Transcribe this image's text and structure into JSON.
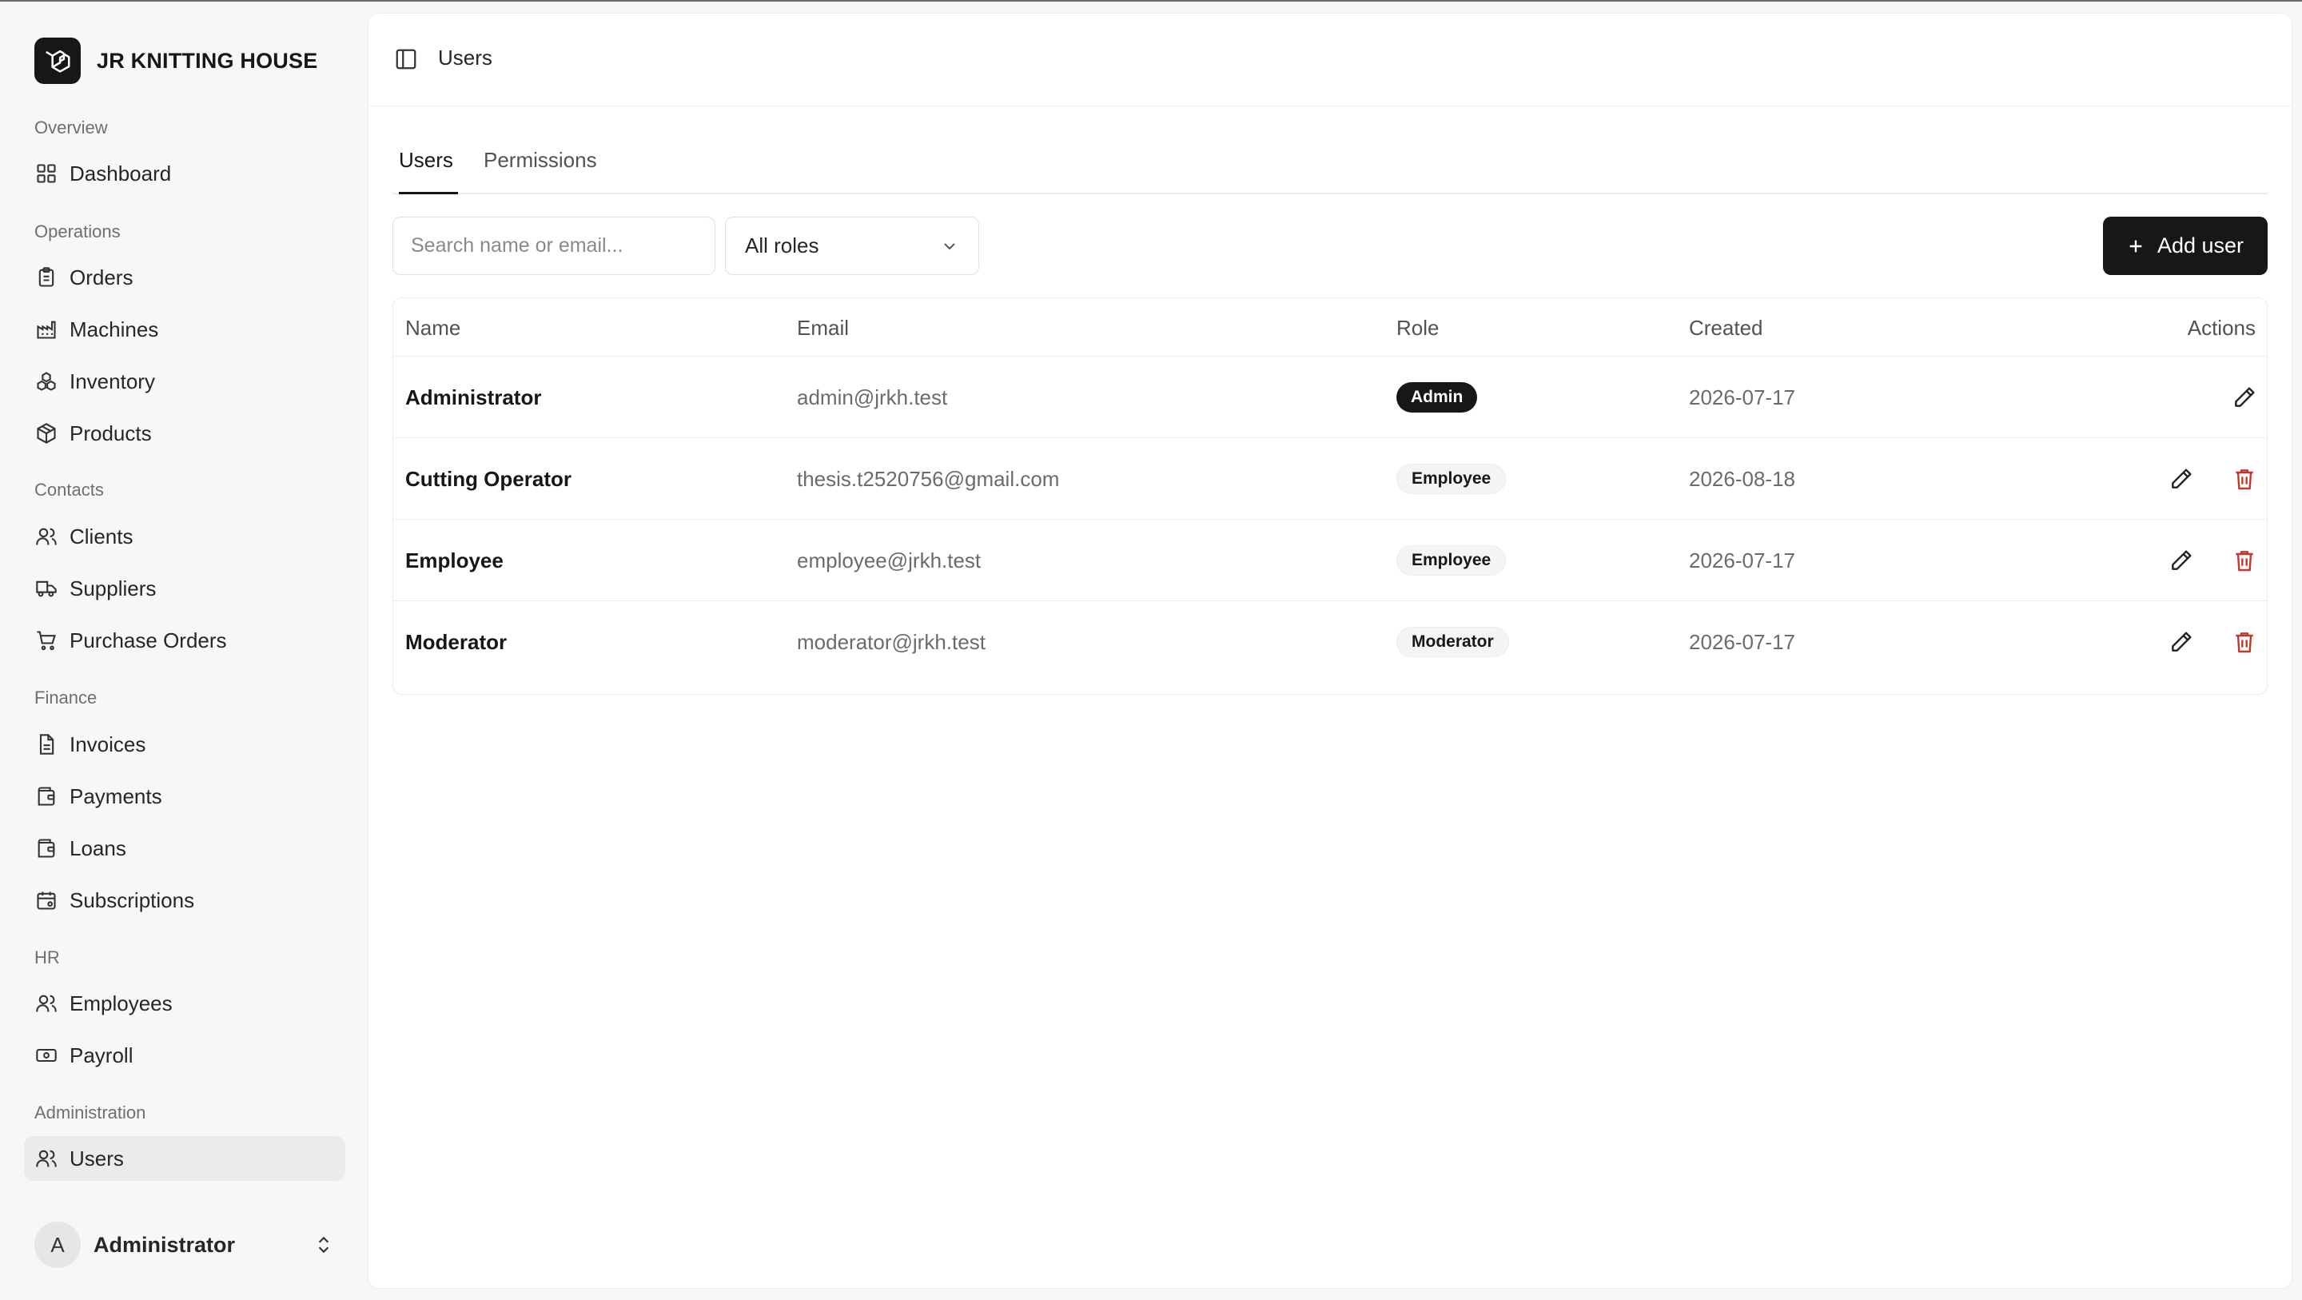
{
  "brand": {
    "name": "JR KNITTING HOUSE"
  },
  "sidebar": {
    "sections": [
      {
        "label": "Overview"
      },
      {
        "label": "Operations"
      },
      {
        "label": "Contacts"
      },
      {
        "label": "Finance"
      },
      {
        "label": "HR"
      },
      {
        "label": "Administration"
      }
    ],
    "items": [
      {
        "label": "Dashboard",
        "icon": "dashboard-grid-icon"
      },
      {
        "label": "Orders",
        "icon": "clipboard-icon"
      },
      {
        "label": "Machines",
        "icon": "factory-icon"
      },
      {
        "label": "Inventory",
        "icon": "boxes-icon"
      },
      {
        "label": "Products",
        "icon": "package-icon"
      },
      {
        "label": "Clients",
        "icon": "users-icon"
      },
      {
        "label": "Suppliers",
        "icon": "truck-icon"
      },
      {
        "label": "Purchase Orders",
        "icon": "cart-icon"
      },
      {
        "label": "Invoices",
        "icon": "file-icon"
      },
      {
        "label": "Payments",
        "icon": "wallet-icon"
      },
      {
        "label": "Loans",
        "icon": "wallet-icon"
      },
      {
        "label": "Subscriptions",
        "icon": "calendar-icon"
      },
      {
        "label": "Employees",
        "icon": "users-icon"
      },
      {
        "label": "Payroll",
        "icon": "banknote-icon"
      },
      {
        "label": "Users",
        "icon": "users-icon",
        "active": true
      }
    ],
    "user": {
      "initial": "A",
      "name": "Administrator"
    }
  },
  "header": {
    "breadcrumb": "Users"
  },
  "tabs": [
    {
      "label": "Users",
      "active": true
    },
    {
      "label": "Permissions",
      "active": false
    }
  ],
  "filters": {
    "search_placeholder": "Search name or email...",
    "role_select": "All roles"
  },
  "toolbar": {
    "add_user_label": "Add user"
  },
  "table": {
    "columns": [
      "Name",
      "Email",
      "Role",
      "Created",
      "Actions"
    ],
    "rows": [
      {
        "name": "Administrator",
        "email": "admin@jrkh.test",
        "role": "Admin",
        "created": "2026-07-17",
        "deletable": false
      },
      {
        "name": "Cutting Operator",
        "email": "thesis.t2520756@gmail.com",
        "role": "Employee",
        "created": "2026-08-18",
        "deletable": true
      },
      {
        "name": "Employee",
        "email": "employee@jrkh.test",
        "role": "Employee",
        "created": "2026-07-17",
        "deletable": true
      },
      {
        "name": "Moderator",
        "email": "moderator@jrkh.test",
        "role": "Moderator",
        "created": "2026-07-17",
        "deletable": true
      }
    ]
  },
  "colors": {
    "accent": "#171717",
    "danger": "#c0392b",
    "muted": "#6b6b6b"
  }
}
